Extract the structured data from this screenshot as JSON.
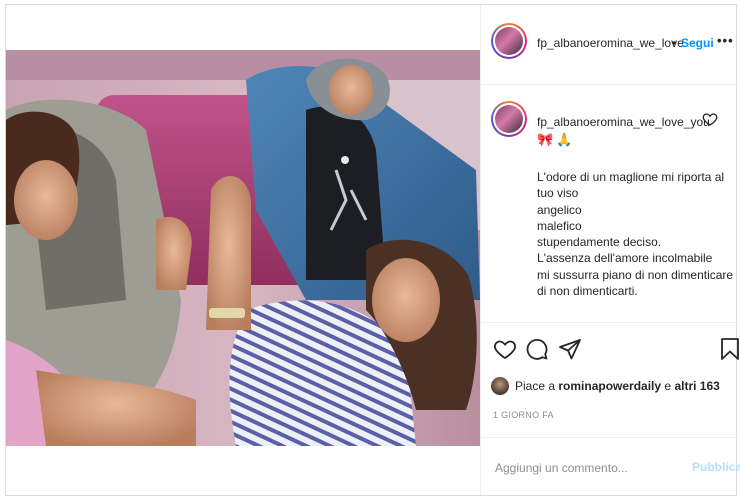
{
  "header": {
    "username": "fp_albanoeromina_we_love",
    "separator": "•",
    "follow_label": "Segui",
    "more_label": "•••"
  },
  "caption": {
    "username": "fp_albanoeromina_we_love_you",
    "emojis": [
      "🎀",
      "🙏"
    ],
    "lines": [
      "L'odore di un maglione mi riporta al",
      "tuo viso",
      "angelico",
      "malefico",
      "stupendamente deciso.",
      "L'assenza dell'amore incolmabile",
      "mi sussurra piano di non dimenticare",
      "di non dimenticarti."
    ]
  },
  "actions": {
    "like_icon": "heart-icon",
    "comment_icon": "comment-icon",
    "share_icon": "share-icon",
    "save_icon": "bookmark-icon"
  },
  "likes": {
    "prefix": "Piace a ",
    "user": "rominapowerdaily",
    "middle": " e ",
    "others": "altri 163"
  },
  "time_ago": "1 GIORNO FA",
  "comment_box": {
    "placeholder": "Aggiungi un commento...",
    "publish_label": "Pubblica"
  },
  "colors": {
    "accent": "#0095f6",
    "publish_disabled": "#b2dffc",
    "border": "#efefef",
    "muted": "#8e8e8e"
  }
}
